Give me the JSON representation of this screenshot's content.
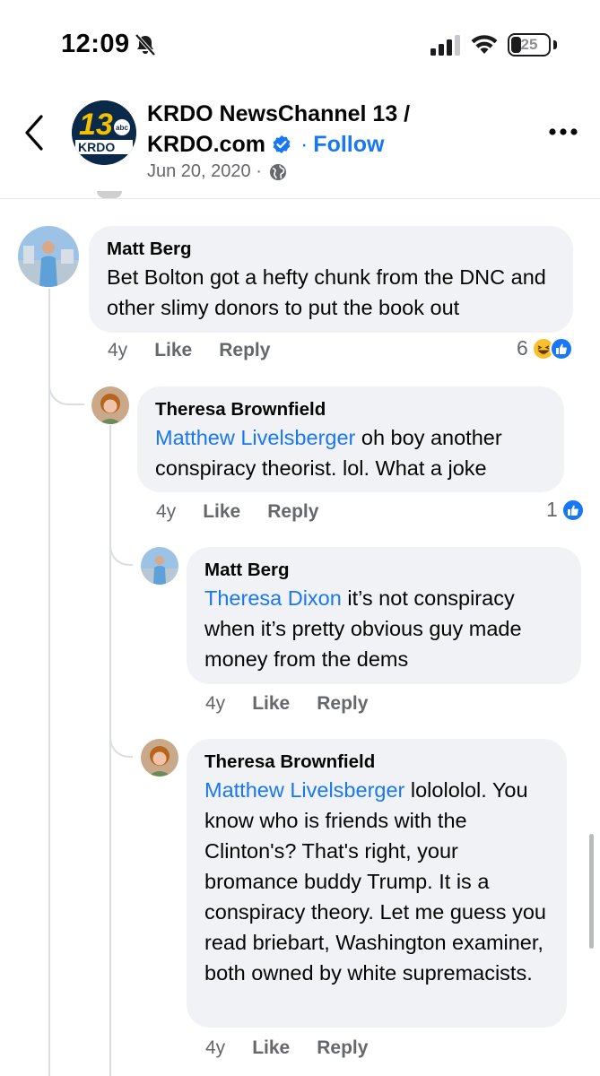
{
  "status_bar": {
    "time": "12:09",
    "battery": "25"
  },
  "header": {
    "page_name_line1": "KRDO NewsChannel 13 /",
    "page_name_line2": "KRDO.com",
    "separator": "·",
    "follow_label": "Follow",
    "date": "Jun 20, 2020 ·",
    "logo_number": "13",
    "logo_abc": "abc",
    "logo_text": "KRDO"
  },
  "comments": [
    {
      "author": "Matt Berg",
      "mention": "",
      "text": "Bet Bolton got a hefty chunk from the DNC and other slimy donors to put the book out",
      "time": "4y",
      "like_label": "Like",
      "reply_label": "Reply",
      "reaction_count": "6"
    },
    {
      "author": "Theresa Brownfield",
      "mention": "Matthew Livelsberger",
      "text": " oh boy another conspiracy theorist. lol. What a joke",
      "time": "4y",
      "like_label": "Like",
      "reply_label": "Reply",
      "reaction_count": "1"
    },
    {
      "author": "Matt Berg",
      "mention": "Theresa Dixon",
      "text": " it’s not conspiracy when it’s pretty obvious guy made money from the dems",
      "time": "4y",
      "like_label": "Like",
      "reply_label": "Reply",
      "reaction_count": ""
    },
    {
      "author": "Theresa Brownfield",
      "mention": "Matthew Livelsberger",
      "text": " lolololol. You know who is friends with the Clinton's? That's right, your bromance buddy Trump. It is a conspiracy theory. Let me guess you read briebart, Washington examiner, both owned by white supremacists.",
      "time": "4y",
      "like_label": "Like",
      "reply_label": "Reply",
      "reaction_count": ""
    }
  ],
  "colors": {
    "accent": "#1877f2",
    "bubble": "#f0f2f5",
    "secondary_text": "#65676b"
  }
}
